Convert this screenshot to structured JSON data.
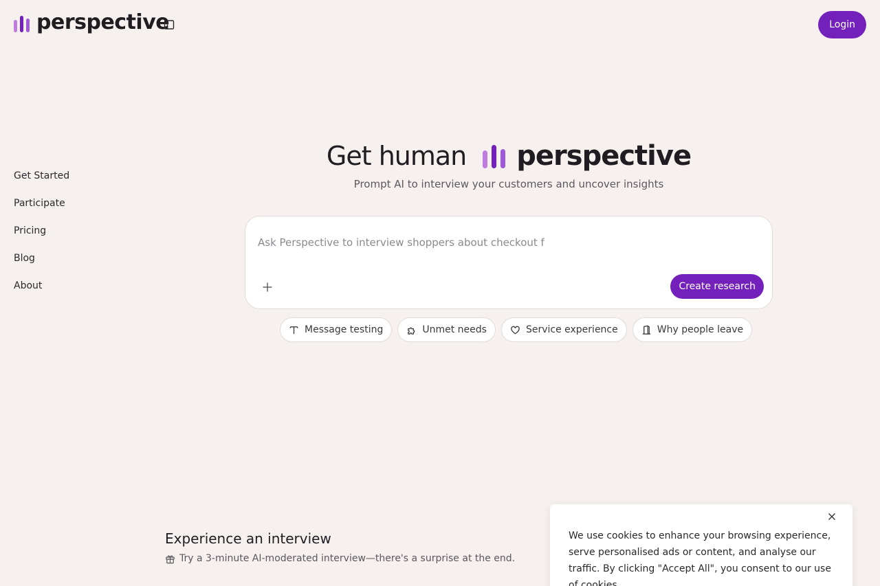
{
  "header": {
    "brand_name": "perspective",
    "login_label": "Login"
  },
  "nav": {
    "items": [
      "Get Started",
      "Participate",
      "Pricing",
      "Blog",
      "About"
    ]
  },
  "hero": {
    "title_lead": "Get human",
    "title_brand": "perspective",
    "subtitle": "Prompt AI to interview your customers and uncover insights"
  },
  "prompt": {
    "placeholder": "Ask Perspective to interview shoppers about checkout f",
    "create_label": "Create research"
  },
  "chips": [
    {
      "label": "Message testing",
      "icon": "text-icon"
    },
    {
      "label": "Unmet needs",
      "icon": "puzzle-icon"
    },
    {
      "label": "Service experience",
      "icon": "heart-icon"
    },
    {
      "label": "Why people leave",
      "icon": "door-icon"
    }
  ],
  "experience": {
    "title": "Experience an interview",
    "subtitle": "Try a 3-minute AI-moderated interview—there's a surprise at the end."
  },
  "cookie": {
    "text": "We use cookies to enhance your browsing experience, serve personalised ads or content, and analyse our traffic. By clicking \"Accept All\", you consent to our use of cookies."
  },
  "colors": {
    "accent": "#7421bb",
    "background": "#f6f1ee",
    "logo_bar_1": "#c07be0",
    "logo_bar_2": "#7421bb",
    "logo_bar_3": "#a05ad8"
  }
}
